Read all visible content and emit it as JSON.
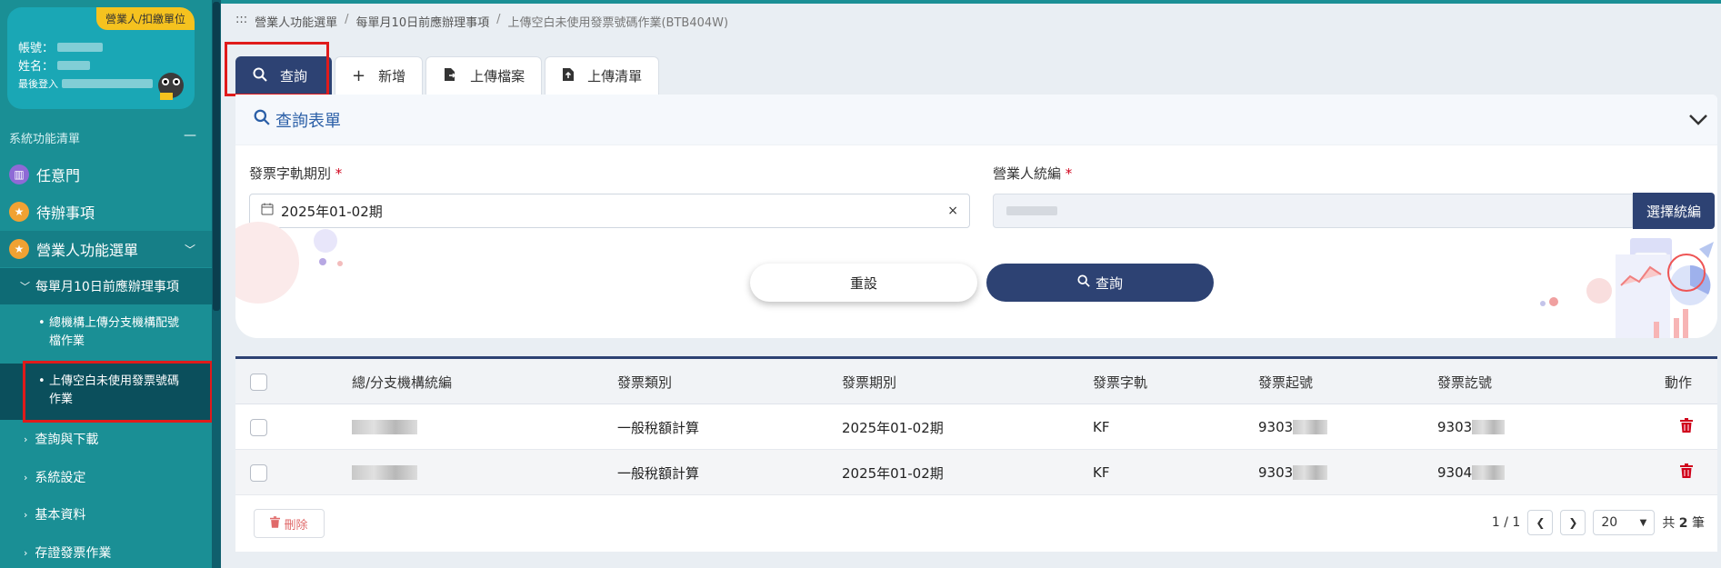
{
  "sidebar": {
    "user": {
      "role": "營業人/扣繳單位",
      "account_label": "帳號：",
      "name_label": "姓名：",
      "last_login_label": "最後登入"
    },
    "section_title": "系統功能清單",
    "collapse_symbol": "—",
    "menu": [
      {
        "label": "任意門",
        "icon": "map-icon",
        "color": "#8e6ad6"
      },
      {
        "label": "待辦事項",
        "icon": "star-icon",
        "color": "#f0a233"
      },
      {
        "label": "營業人功能選單",
        "icon": "star-icon",
        "color": "#f0a233"
      }
    ],
    "submenu_head": "每單月10日前應辦理事項",
    "sub_leaves": [
      "總機構上傳分支機構配號檔作業",
      "上傳空白未使用發票號碼作業"
    ],
    "groups": [
      "查詢與下載",
      "系統設定",
      "基本資料",
      "存證發票作業"
    ]
  },
  "breadcrumb": {
    "prefix": ":::",
    "items": [
      "營業人功能選單",
      "每單月10日前應辦理事項",
      "上傳空白未使用發票號碼作業(BTB404W)"
    ]
  },
  "tabs": [
    {
      "label": "查詢",
      "icon": "search-icon"
    },
    {
      "label": "新增",
      "icon": "plus-icon"
    },
    {
      "label": "上傳檔案",
      "icon": "file-upload-icon"
    },
    {
      "label": "上傳清單",
      "icon": "upload-list-icon"
    }
  ],
  "form": {
    "title": "查詢表單",
    "period_label": "發票字軌期別",
    "period_value": "2025年01-02期",
    "vat_label": "營業人統編",
    "choose_button": "選擇統編",
    "reset_button": "重設",
    "search_button": "查詢",
    "required_mark": "*"
  },
  "table": {
    "headers": [
      "總/分支機構統編",
      "發票類別",
      "發票期別",
      "發票字軌",
      "發票起號",
      "發票訖號",
      "動作"
    ],
    "rows": [
      {
        "category": "一般稅額計算",
        "period": "2025年01-02期",
        "track": "KF",
        "start": "9303",
        "end": "9303"
      },
      {
        "category": "一般稅額計算",
        "period": "2025年01-02期",
        "track": "KF",
        "start": "9303",
        "end": "9304"
      }
    ],
    "delete_button": "刪除",
    "pagination": {
      "page": "1 / 1",
      "page_size": "20",
      "total_prefix": "共",
      "total_count": "2",
      "total_suffix": "筆"
    }
  },
  "colors": {
    "primary": "#2d4273",
    "sidebar": "#1a8f95",
    "danger": "#d0021b",
    "highlight": "#e01b1b"
  }
}
